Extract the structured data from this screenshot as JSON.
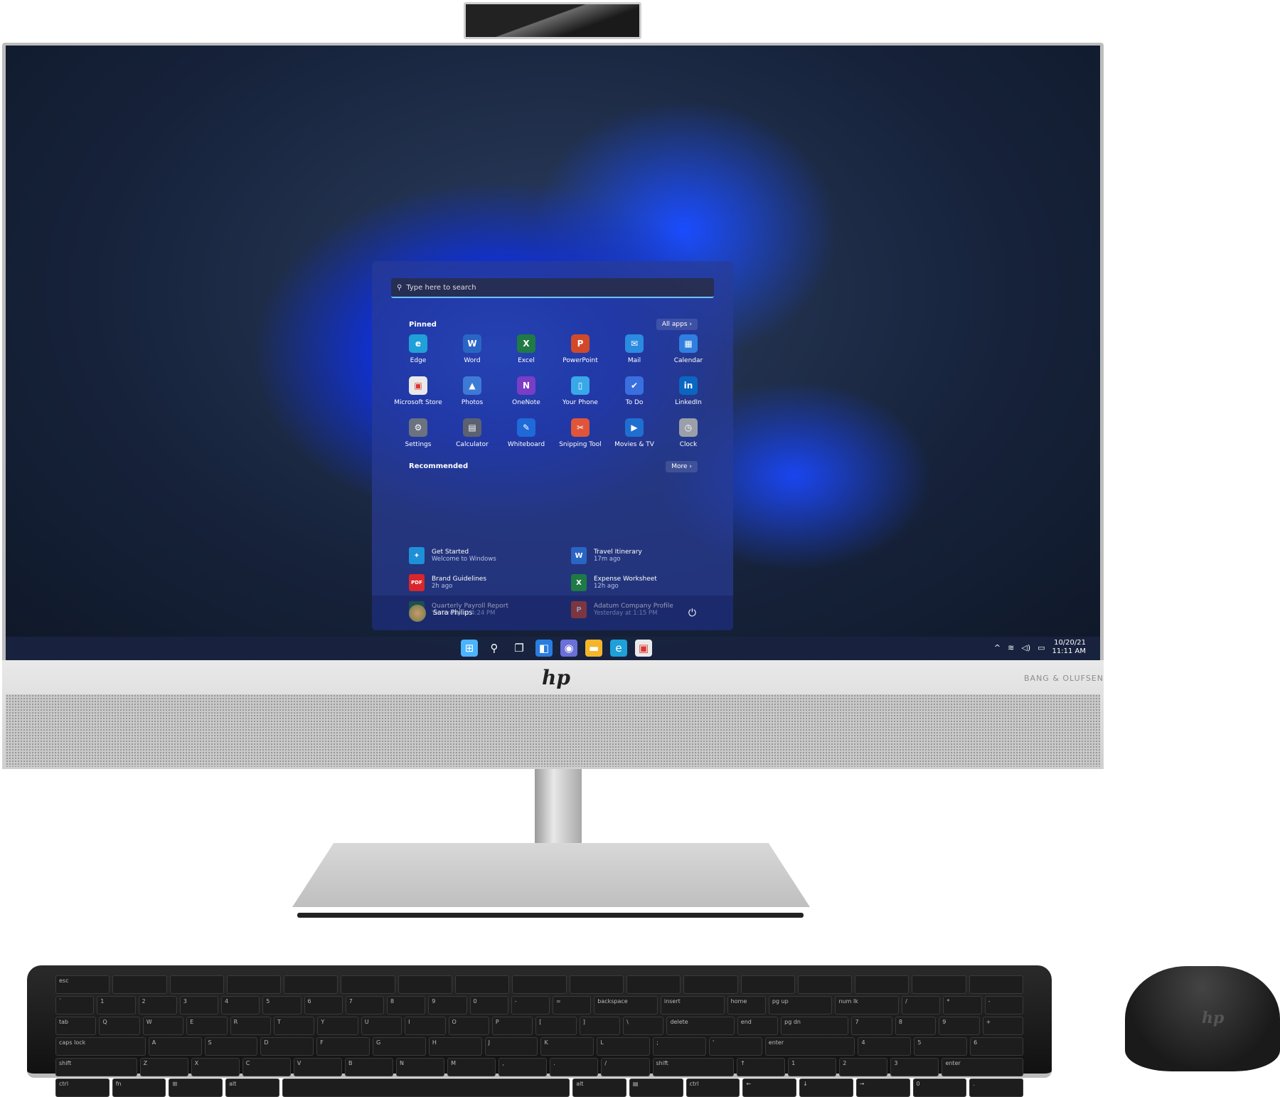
{
  "start_menu": {
    "search_placeholder": "Type here to search",
    "pinned_label": "Pinned",
    "all_apps_label": "All apps",
    "pinned": [
      {
        "label": "Edge",
        "glyph": "e",
        "color": "#1fa0d8"
      },
      {
        "label": "Word",
        "glyph": "W",
        "color": "#2b65c4"
      },
      {
        "label": "Excel",
        "glyph": "X",
        "color": "#1f7a45"
      },
      {
        "label": "PowerPoint",
        "glyph": "P",
        "color": "#d2492a"
      },
      {
        "label": "Mail",
        "glyph": "✉",
        "color": "#2a8be0"
      },
      {
        "label": "Calendar",
        "glyph": "▦",
        "color": "#2f7fe0"
      },
      {
        "label": "Microsoft Store",
        "glyph": "▣",
        "color": "#e9e9e9"
      },
      {
        "label": "Photos",
        "glyph": "▲",
        "color": "#3d7ad6"
      },
      {
        "label": "OneNote",
        "glyph": "N",
        "color": "#7b3cc6"
      },
      {
        "label": "Your Phone",
        "glyph": "▯",
        "color": "#38a8e8"
      },
      {
        "label": "To Do",
        "glyph": "✔",
        "color": "#3a6fe0"
      },
      {
        "label": "LinkedIn",
        "glyph": "in",
        "color": "#0a66c2"
      },
      {
        "label": "Settings",
        "glyph": "⚙",
        "color": "#6b7280"
      },
      {
        "label": "Calculator",
        "glyph": "▤",
        "color": "#5b6170"
      },
      {
        "label": "Whiteboard",
        "glyph": "✎",
        "color": "#1e6ad8"
      },
      {
        "label": "Snipping Tool",
        "glyph": "✂",
        "color": "#e0553a"
      },
      {
        "label": "Movies & TV",
        "glyph": "▶",
        "color": "#1f6fd0"
      },
      {
        "label": "Clock",
        "glyph": "◷",
        "color": "#9aa0aa"
      }
    ],
    "recommended_label": "Recommended",
    "more_label": "More",
    "recommended": [
      {
        "title": "Get Started",
        "subtitle": "Welcome to Windows",
        "glyph": "✦",
        "color": "#1e90d8"
      },
      {
        "title": "Travel Itinerary",
        "subtitle": "17m ago",
        "glyph": "W",
        "color": "#2b65c4"
      },
      {
        "title": "Brand Guidelines",
        "subtitle": "2h ago",
        "glyph": "PDF",
        "color": "#d9262c"
      },
      {
        "title": "Expense Worksheet",
        "subtitle": "12h ago",
        "glyph": "X",
        "color": "#1f7a45"
      },
      {
        "title": "Quarterly Payroll Report",
        "subtitle": "Yesterday at 4:24 PM",
        "glyph": "X",
        "color": "#1f7a45"
      },
      {
        "title": "Adatum Company Profile",
        "subtitle": "Yesterday at 1:15 PM",
        "glyph": "P",
        "color": "#d2492a"
      }
    ],
    "user_name": "Sara Philips"
  },
  "taskbar": {
    "icons": [
      {
        "name": "start",
        "glyph": "⊞",
        "color": "#4cb3ff"
      },
      {
        "name": "search",
        "glyph": "⚲",
        "color": "transparent"
      },
      {
        "name": "task-view",
        "glyph": "❐",
        "color": "transparent"
      },
      {
        "name": "widgets",
        "glyph": "◧",
        "color": "#2a7de0"
      },
      {
        "name": "teams-chat",
        "glyph": "◉",
        "color": "#6b6fd8"
      },
      {
        "name": "file-explorer",
        "glyph": "▬",
        "color": "#f3b52a"
      },
      {
        "name": "edge",
        "glyph": "e",
        "color": "#1fa0d8"
      },
      {
        "name": "store",
        "glyph": "▣",
        "color": "#e9e9e9"
      }
    ],
    "date": "10/20/21",
    "time": "11:11 AM"
  },
  "hardware": {
    "brand_logo": "hp",
    "speaker_brand": "BANG & OLUFSEN"
  },
  "keyboard": {
    "rows": [
      [
        "esc",
        "",
        "",
        "",
        "",
        "",
        "",
        "",
        "",
        "",
        "",
        "",
        "",
        "",
        "",
        "",
        ""
      ],
      [
        "`",
        "1",
        "2",
        "3",
        "4",
        "5",
        "6",
        "7",
        "8",
        "9",
        "0",
        "-",
        "=",
        "backspace",
        "insert",
        "home",
        "pg up",
        "num lk",
        "/",
        "*",
        "-"
      ],
      [
        "tab",
        "Q",
        "W",
        "E",
        "R",
        "T",
        "Y",
        "U",
        "I",
        "O",
        "P",
        "[",
        "]",
        "\\",
        "delete",
        "end",
        "pg dn",
        "7",
        "8",
        "9",
        "+"
      ],
      [
        "caps lock",
        "A",
        "S",
        "D",
        "F",
        "G",
        "H",
        "J",
        "K",
        "L",
        ";",
        "'",
        "enter",
        "4",
        "5",
        "6"
      ],
      [
        "shift",
        "Z",
        "X",
        "C",
        "V",
        "B",
        "N",
        "M",
        ",",
        ".",
        "/",
        "shift",
        "↑",
        "1",
        "2",
        "3",
        "enter"
      ],
      [
        "ctrl",
        "fn",
        "⊞",
        "alt",
        "",
        "alt",
        "▤",
        "ctrl",
        "←",
        "↓",
        "→",
        "0",
        "."
      ]
    ]
  }
}
